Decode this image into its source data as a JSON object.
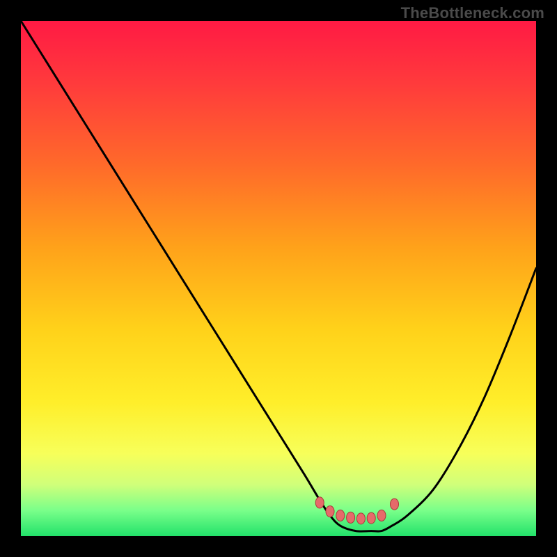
{
  "watermark": "TheBottleneck.com",
  "colors": {
    "curve": "#000000",
    "marker_fill": "#e66a6a",
    "marker_stroke": "#aa3a3a"
  },
  "chart_data": {
    "type": "line",
    "title": "",
    "xlabel": "",
    "ylabel": "",
    "xlim": [
      0,
      100
    ],
    "ylim": [
      0,
      100
    ],
    "grid": false,
    "x": [
      0,
      5,
      10,
      15,
      20,
      25,
      30,
      35,
      40,
      45,
      50,
      55,
      58,
      60,
      62,
      65,
      68,
      70,
      72,
      75,
      80,
      85,
      90,
      95,
      100
    ],
    "y": [
      100,
      92,
      84,
      76,
      68,
      60,
      52,
      44,
      36,
      28,
      20,
      12,
      7,
      4,
      2,
      1,
      1,
      1,
      2,
      4,
      9,
      17,
      27,
      39,
      52
    ],
    "markers_x": [
      58,
      60,
      62,
      64,
      66,
      68,
      70,
      72.5
    ],
    "markers_y": [
      6.5,
      4.8,
      4.0,
      3.6,
      3.4,
      3.5,
      4.0,
      6.2
    ]
  }
}
